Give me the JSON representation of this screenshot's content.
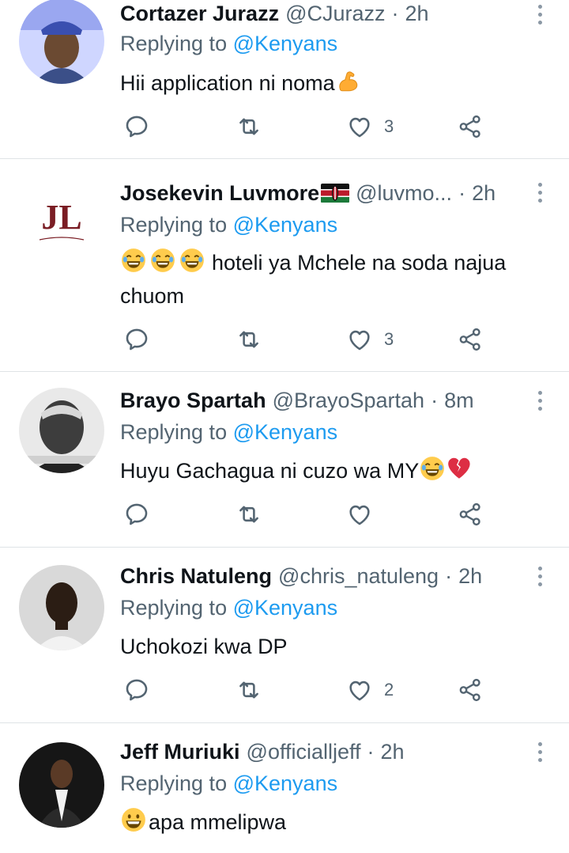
{
  "replying_prefix": "Replying to",
  "tweets": [
    {
      "name": "Cortazer Jurazz",
      "handle": "@CJurazz",
      "dot": "·",
      "time": "2h",
      "reply_to": "@Kenyans",
      "text": "Hii application ni noma",
      "like_count": "3"
    },
    {
      "name": "Josekevin Luvmore",
      "handle": "@luvmo...",
      "dot": "·",
      "time": "2h",
      "reply_to": "@Kenyans",
      "text": "hoteli ya Mchele na soda najua chuom",
      "like_count": "3",
      "avatar_text": "JL"
    },
    {
      "name": "Brayo Spartah",
      "handle": "@BrayoSpartah",
      "dot": "·",
      "time": "8m",
      "reply_to": "@Kenyans",
      "text": "Huyu Gachagua ni cuzo wa MY",
      "like_count": ""
    },
    {
      "name": "Chris Natuleng",
      "handle": "@chris_natuleng",
      "dot": "·",
      "time": "2h",
      "reply_to": "@Kenyans",
      "text": "Uchokozi kwa DP",
      "like_count": "2"
    },
    {
      "name": "Jeff Muriuki",
      "handle": "@officialljeff",
      "dot": "·",
      "time": "2h",
      "reply_to": "@Kenyans",
      "text": "apa mmelipwa"
    }
  ],
  "colors": {
    "link": "#1d9bf0",
    "muted": "#536471",
    "divider": "#dfe3e6",
    "icon": "#536471"
  },
  "icons": [
    "reply-icon",
    "retweet-icon",
    "like-icon",
    "share-icon",
    "more-icon"
  ]
}
